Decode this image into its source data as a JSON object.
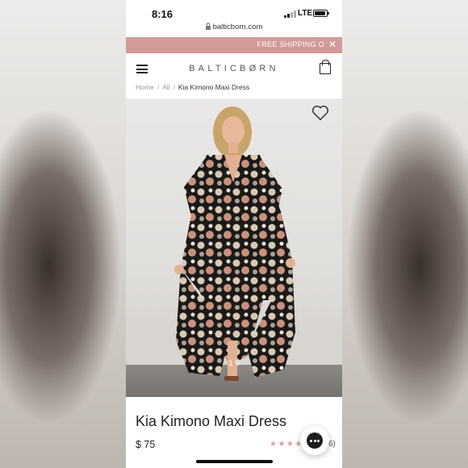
{
  "status_bar": {
    "time": "8:16",
    "network": "LTE"
  },
  "browser": {
    "url": "balticborn.com"
  },
  "promo": {
    "text": "FREE SHIPPING O"
  },
  "header": {
    "logo": "BALTICBØRN"
  },
  "breadcrumb": {
    "home": "Home",
    "all": "All",
    "current": "Kia Kimono Maxi Dress"
  },
  "product": {
    "title": "Kia Kimono Maxi Dress",
    "price": "$ 75",
    "image_counter": "1  6",
    "rating_stars": "★★★★",
    "reviews_count": "6)"
  },
  "icons": {
    "menu": "hamburger-menu-icon",
    "cart": "shopping-bag-icon",
    "wishlist": "heart-icon",
    "close": "close-icon",
    "chat": "chat-icon"
  },
  "colors": {
    "promo_bar": "#d39a9a",
    "stars": "#d4a3a3"
  }
}
